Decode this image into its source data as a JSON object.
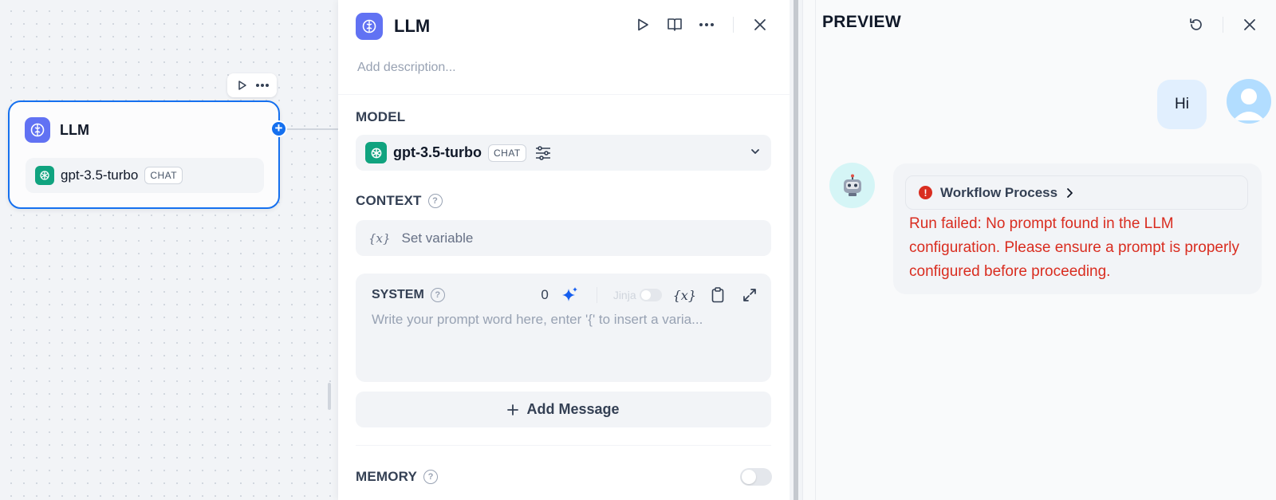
{
  "canvas": {
    "node": {
      "title": "LLM",
      "model": "gpt-3.5-turbo",
      "badge": "CHAT"
    }
  },
  "panel": {
    "title": "LLM",
    "description_placeholder": "Add description...",
    "model_section": {
      "label": "MODEL",
      "model": "gpt-3.5-turbo",
      "badge": "CHAT"
    },
    "context_section": {
      "label": "CONTEXT",
      "variable_glyph": "{x}",
      "placeholder": "Set variable"
    },
    "system_section": {
      "label": "SYSTEM",
      "token_count": "0",
      "jinja_label": "Jinja",
      "variable_glyph": "{x}",
      "placeholder": "Write your prompt word here, enter '{' to insert a varia..."
    },
    "add_message_label": "Add Message",
    "memory_section": {
      "label": "MEMORY"
    }
  },
  "preview": {
    "title": "PREVIEW",
    "user_message": "Hi",
    "workflow_label": "Workflow Process",
    "error_message": "Run failed: No prompt found in the LLM configuration. Please ensure a prompt is properly configured before proceeding."
  },
  "colors": {
    "accent": "#1570ef",
    "llm_icon": "#6172f3",
    "openai_green": "#10a37f",
    "error": "#d92d20",
    "user_bubble": "#e1effe"
  },
  "icons": [
    "play-icon",
    "book-icon",
    "more-icon",
    "close-icon",
    "brain-icon",
    "openai-icon",
    "sliders-icon",
    "chevron-down-icon",
    "help-icon",
    "sparkle-icon",
    "clipboard-icon",
    "expand-icon",
    "plus-icon",
    "refresh-icon",
    "robot-icon",
    "user-icon",
    "error-icon",
    "chevron-right-icon"
  ]
}
